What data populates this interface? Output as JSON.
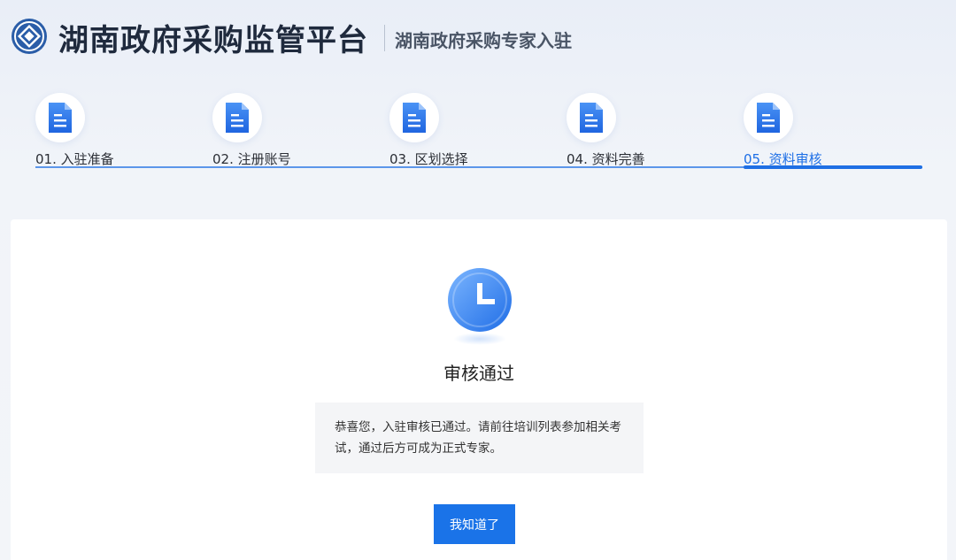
{
  "header": {
    "platform_title": "湖南政府采购监管平台",
    "sub_title": "湖南政府采购专家入驻"
  },
  "steps": [
    {
      "label": "01. 入驻准备",
      "active": false
    },
    {
      "label": "02. 注册账号",
      "active": false
    },
    {
      "label": "03. 区划选择",
      "active": false
    },
    {
      "label": "04. 资料完善",
      "active": false
    },
    {
      "label": "05. 资料审核",
      "active": true
    }
  ],
  "result": {
    "status_title": "审核通过",
    "message": "恭喜您，入驻审核已通过。请前往培训列表参加相关考试，通过后方可成为正式专家。",
    "confirm_label": "我知道了"
  },
  "colors": {
    "accent": "#1a73e8",
    "active_step": "#1d6fe6"
  },
  "icons": {
    "logo": "platform-logo-icon",
    "step": "document-icon",
    "status": "clock-icon"
  }
}
